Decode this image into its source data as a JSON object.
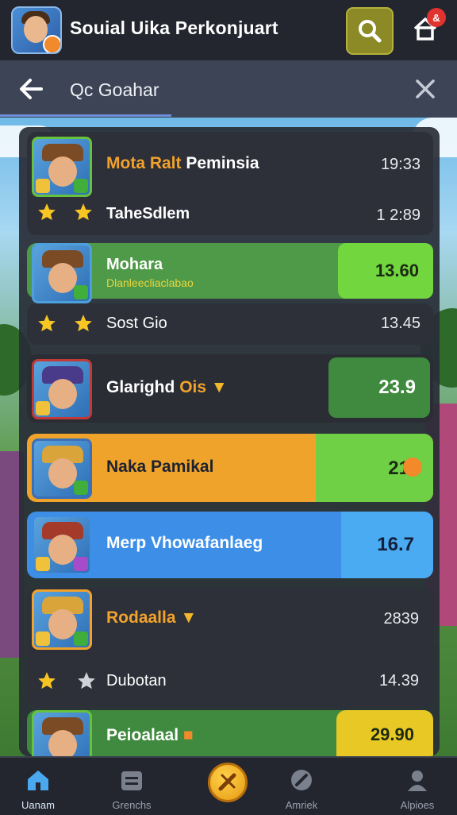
{
  "header": {
    "app_title": "Souial Uika Perkonjuart",
    "notification_count": "&"
  },
  "search": {
    "query": "Qc Goahar"
  },
  "rows": [
    {
      "name_a": "Mota Ralt",
      "name_b": "Peminsia",
      "value": "19:33"
    },
    {
      "name": "TaheSdlem",
      "value": "1 2:89",
      "stars": 2
    },
    {
      "name": "Mohara",
      "subtitle": "Dlanleecliaclabao",
      "value": "13.60"
    },
    {
      "name": "Sost Gio",
      "value": "13.45",
      "stars": 2
    },
    {
      "name_a": "Glarighd",
      "name_b": "Ois",
      "value": "23.9"
    },
    {
      "name": "Naka Pamikal",
      "value": "21"
    },
    {
      "name": "Merp Vhowafanlaeg",
      "value": "16.7"
    },
    {
      "name": "Rodaalla",
      "value": "2839"
    },
    {
      "name": "Dubotan",
      "value": "14.39",
      "stars": 2
    },
    {
      "name": "Peioalaal",
      "value": "29.90"
    }
  ],
  "nav": {
    "home": "Uanam",
    "grams": "Grenchs",
    "market": "Amriek",
    "apps": "Alpioes"
  },
  "colors": {
    "accent_green": "#66c13c",
    "accent_orange": "#f2a22b",
    "accent_blue": "#3d8ee6",
    "accent_yellow": "#e8c825"
  },
  "icons": [
    "search-icon",
    "home-icon",
    "back-arrow-icon",
    "close-icon",
    "star-icon",
    "home-nav-icon",
    "grams-nav-icon",
    "center-action-icon",
    "market-nav-icon",
    "apps-nav-icon"
  ]
}
